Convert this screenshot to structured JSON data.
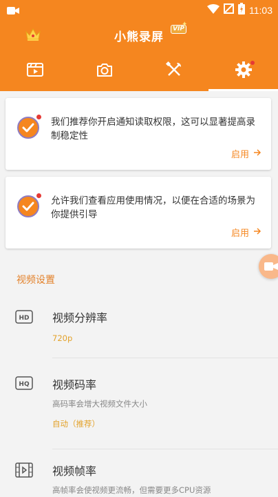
{
  "status_bar": {
    "time": "11:03"
  },
  "header": {
    "title": "小熊录屏",
    "vip_label": "VIP"
  },
  "tabs": [
    {
      "name": "videos"
    },
    {
      "name": "screenshots"
    },
    {
      "name": "tools"
    },
    {
      "name": "settings",
      "active": true
    }
  ],
  "cards": [
    {
      "text": "我们推荐你开启通知读取权限，这可以显著提高录制稳定性",
      "action": "启用"
    },
    {
      "text": "允许我们查看应用使用情况，以便在合适的场景为你提供引导",
      "action": "启用"
    }
  ],
  "section": {
    "title": "视频设置"
  },
  "settings": [
    {
      "icon": "hd-icon",
      "title": "视频分辨率",
      "value": "720p"
    },
    {
      "icon": "hq-icon",
      "title": "视频码率",
      "desc": "高码率会增大视频文件大小",
      "value": "自动（推荐）"
    },
    {
      "icon": "film-icon",
      "title": "视频帧率",
      "desc": "高帧率会使视频更流畅，但需要更多CPU资源"
    }
  ],
  "colors": {
    "accent": "#f5861f",
    "value_text": "#e3a22a",
    "notification_dot": "#e53935"
  }
}
